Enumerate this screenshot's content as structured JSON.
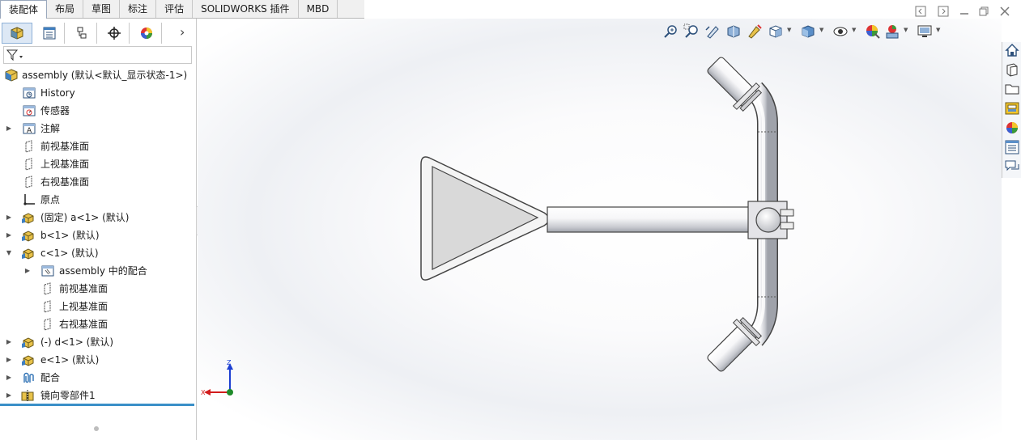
{
  "tabs": [
    {
      "label": "装配体",
      "active": true
    },
    {
      "label": "布局",
      "active": false
    },
    {
      "label": "草图",
      "active": false
    },
    {
      "label": "标注",
      "active": false
    },
    {
      "label": "评估",
      "active": false
    },
    {
      "label": "SOLIDWORKS 插件",
      "active": false
    },
    {
      "label": "MBD",
      "active": false
    }
  ],
  "panel_tabs": [
    "featuremanager-icon",
    "propertymanager-icon",
    "configurationmanager-icon",
    "dimxpert-icon",
    "display-manager-icon"
  ],
  "panel_more": "›",
  "tree": {
    "root": "assembly  (默认<默认_显示状态-1>)",
    "items": [
      {
        "label": "History",
        "icon": "history-icon"
      },
      {
        "label": "传感器",
        "icon": "sensor-icon"
      },
      {
        "label": "注解",
        "icon": "annotation-icon"
      },
      {
        "label": "前视基准面",
        "icon": "plane-icon"
      },
      {
        "label": "上视基准面",
        "icon": "plane-icon"
      },
      {
        "label": "右视基准面",
        "icon": "plane-icon"
      },
      {
        "label": "原点",
        "icon": "origin-icon"
      },
      {
        "label": "(固定) a<1> (默认)",
        "icon": "part-icon"
      },
      {
        "label": "b<1> (默认)",
        "icon": "part-icon"
      },
      {
        "label": "c<1> (默认)",
        "icon": "part-icon"
      },
      {
        "label": "assembly 中的配合",
        "icon": "mates-folder-icon"
      },
      {
        "label": "前视基准面",
        "icon": "plane-icon"
      },
      {
        "label": "上视基准面",
        "icon": "plane-icon"
      },
      {
        "label": "右视基准面",
        "icon": "plane-icon"
      },
      {
        "label": "(-) d<1> (默认)",
        "icon": "part-icon"
      },
      {
        "label": "e<1> (默认)",
        "icon": "part-icon"
      },
      {
        "label": "配合",
        "icon": "mates-icon"
      },
      {
        "label": "镜向零部件1",
        "icon": "mirror-component-icon"
      }
    ]
  },
  "triad": {
    "z": "Z",
    "x": "X"
  },
  "colors": {
    "accent": "#3a8fc8",
    "part_yellow": "#e8c24a",
    "triad_red": "#d21c1c",
    "triad_blue": "#1c3fd2",
    "triad_green": "#1e8a2a"
  }
}
